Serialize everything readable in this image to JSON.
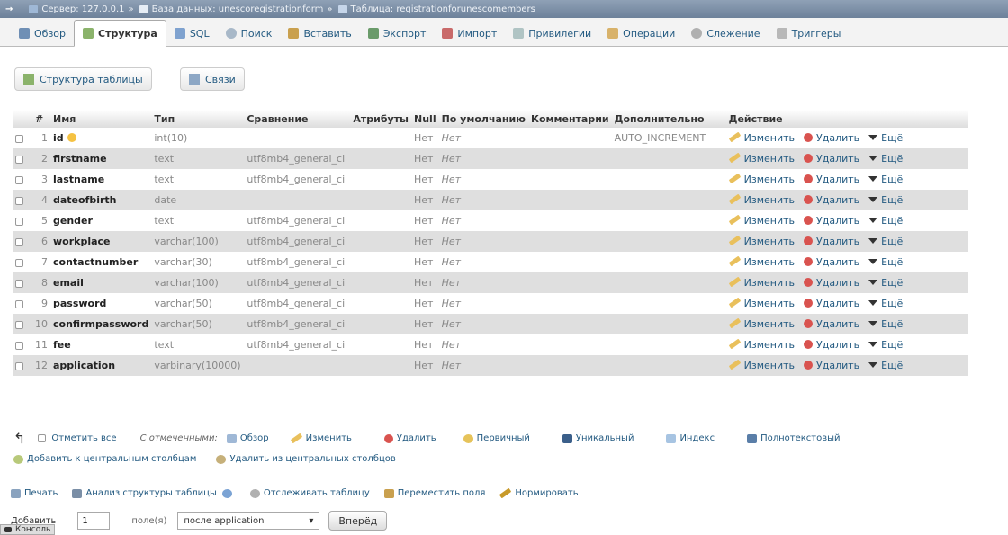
{
  "breadcrumb": {
    "server": "Сервер: 127.0.0.1",
    "database": "База данных: unescoregistrationform",
    "table": "Таблица: registrationforunescomembers"
  },
  "tabs": [
    {
      "label": "Обзор",
      "icon": "browse-icon",
      "color": "#6f8fb5"
    },
    {
      "label": "Структура",
      "icon": "structure-icon",
      "color": "#8bb36b"
    },
    {
      "label": "SQL",
      "icon": "sql-icon",
      "color": "#7fa2cf"
    },
    {
      "label": "Поиск",
      "icon": "search-icon",
      "color": "#8aa"
    },
    {
      "label": "Вставить",
      "icon": "insert-icon",
      "color": "#c9a04e"
    },
    {
      "label": "Экспорт",
      "icon": "export-icon",
      "color": "#6a9b6a"
    },
    {
      "label": "Импорт",
      "icon": "import-icon",
      "color": "#c96a6a"
    },
    {
      "label": "Привилегии",
      "icon": "privileges-icon",
      "color": "#9aa"
    },
    {
      "label": "Операции",
      "icon": "operations-icon",
      "color": "#c9a04e"
    },
    {
      "label": "Слежение",
      "icon": "tracking-icon",
      "color": "#9a9a9a"
    },
    {
      "label": "Триггеры",
      "icon": "triggers-icon",
      "color": "#9a9a9a"
    }
  ],
  "subtabs": {
    "structure": "Структура таблицы",
    "relations": "Связи"
  },
  "columns": [
    "#",
    "Имя",
    "Тип",
    "Сравнение",
    "Атрибуты",
    "Null",
    "По умолчанию",
    "Комментарии",
    "Дополнительно",
    "Действие"
  ],
  "rows": [
    {
      "num": "1",
      "name": "id",
      "type": "int(10)",
      "collation": "",
      "null": "Нет",
      "default": "Нет",
      "extra": "AUTO_INCREMENT",
      "primary": true
    },
    {
      "num": "2",
      "name": "firstname",
      "type": "text",
      "collation": "utf8mb4_general_ci",
      "null": "Нет",
      "default": "Нет",
      "extra": ""
    },
    {
      "num": "3",
      "name": "lastname",
      "type": "text",
      "collation": "utf8mb4_general_ci",
      "null": "Нет",
      "default": "Нет",
      "extra": ""
    },
    {
      "num": "4",
      "name": "dateofbirth",
      "type": "date",
      "collation": "",
      "null": "Нет",
      "default": "Нет",
      "extra": ""
    },
    {
      "num": "5",
      "name": "gender",
      "type": "text",
      "collation": "utf8mb4_general_ci",
      "null": "Нет",
      "default": "Нет",
      "extra": ""
    },
    {
      "num": "6",
      "name": "workplace",
      "type": "varchar(100)",
      "collation": "utf8mb4_general_ci",
      "null": "Нет",
      "default": "Нет",
      "extra": ""
    },
    {
      "num": "7",
      "name": "contactnumber",
      "type": "varchar(30)",
      "collation": "utf8mb4_general_ci",
      "null": "Нет",
      "default": "Нет",
      "extra": ""
    },
    {
      "num": "8",
      "name": "email",
      "type": "varchar(100)",
      "collation": "utf8mb4_general_ci",
      "null": "Нет",
      "default": "Нет",
      "extra": ""
    },
    {
      "num": "9",
      "name": "password",
      "type": "varchar(50)",
      "collation": "utf8mb4_general_ci",
      "null": "Нет",
      "default": "Нет",
      "extra": ""
    },
    {
      "num": "10",
      "name": "confirmpassword",
      "type": "varchar(50)",
      "collation": "utf8mb4_general_ci",
      "null": "Нет",
      "default": "Нет",
      "extra": ""
    },
    {
      "num": "11",
      "name": "fee",
      "type": "text",
      "collation": "utf8mb4_general_ci",
      "null": "Нет",
      "default": "Нет",
      "extra": ""
    },
    {
      "num": "12",
      "name": "application",
      "type": "varbinary(10000)",
      "collation": "",
      "null": "Нет",
      "default": "Нет",
      "extra": ""
    }
  ],
  "actions": {
    "edit": "Изменить",
    "delete": "Удалить",
    "more": "Ещё"
  },
  "bulk": {
    "check_all": "Отметить все",
    "with_selected": "С отмеченными:",
    "browse": "Обзор",
    "edit": "Изменить",
    "delete": "Удалить",
    "primary": "Первичный",
    "unique": "Уникальный",
    "index": "Индекс",
    "fulltext": "Полнотекстовый",
    "add_central": "Добавить к центральным столбцам",
    "remove_central": "Удалить из центральных столбцов"
  },
  "tools": {
    "print": "Печать",
    "analyze": "Анализ структуры таблицы",
    "track": "Отслеживать таблицу",
    "move": "Переместить поля",
    "normalize": "Нормировать"
  },
  "add_fields": {
    "label": "Добавить",
    "count": "1",
    "unit": "поле(я)",
    "position": "после application",
    "go": "Вперёд"
  },
  "console": "Консоль"
}
